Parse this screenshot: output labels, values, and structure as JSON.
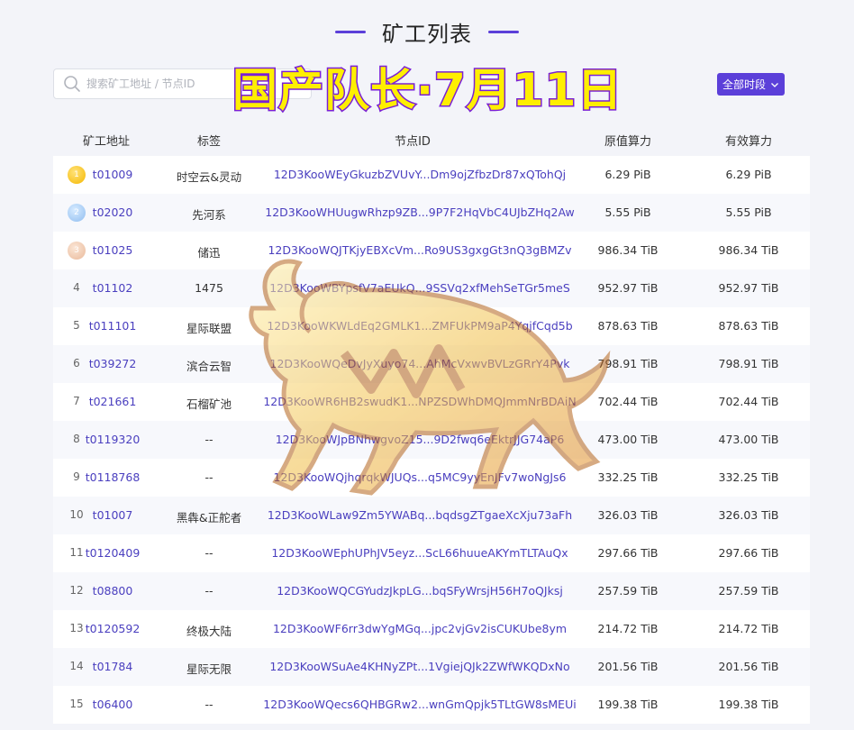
{
  "page": {
    "title": "矿工列表",
    "search_placeholder": "搜索矿工地址 / 节点ID",
    "overlay_text": "国产队长·7月11日",
    "period_button": "全部时段"
  },
  "colors": {
    "accent": "#5b3fd9",
    "link": "#4a3fbf",
    "overlay_fill": "#ffef00",
    "overlay_stroke": "#7a1fd6"
  },
  "table": {
    "headers": {
      "miner": "矿工地址",
      "tag": "标签",
      "node": "节点ID",
      "raw_power": "原值算力",
      "effective_power": "有效算力"
    },
    "rows": [
      {
        "rank": "1",
        "miner": "t01009",
        "tag": "时空云&灵动",
        "node": "12D3KooWEyGkuzbZVUvY...Dm9ojZfbzDr87xQTohQj",
        "raw": "6.29 PiB",
        "eff": "6.29 PiB"
      },
      {
        "rank": "2",
        "miner": "t02020",
        "tag": "先河系",
        "node": "12D3KooWHUugwRhzp9ZB...9P7F2HqVbC4UJbZHq2Aw",
        "raw": "5.55 PiB",
        "eff": "5.55 PiB"
      },
      {
        "rank": "3",
        "miner": "t01025",
        "tag": "储迅",
        "node": "12D3KooWQJTKjyEBXcVm...Ro9US3gxgGt3nQ3gBMZv",
        "raw": "986.34 TiB",
        "eff": "986.34 TiB"
      },
      {
        "rank": "4",
        "miner": "t01102",
        "tag": "1475",
        "node": "12D3KooWBYpsfV7aEUkQ...9SSVq2xfMehSeTGr5meS",
        "raw": "952.97 TiB",
        "eff": "952.97 TiB"
      },
      {
        "rank": "5",
        "miner": "t011101",
        "tag": "星际联盟",
        "node": "12D3KooWKWLdEq2GMLK1...ZMFUkPM9aP4YqjfCqd5b",
        "raw": "878.63 TiB",
        "eff": "878.63 TiB"
      },
      {
        "rank": "6",
        "miner": "t039272",
        "tag": "滨合云智",
        "node": "12D3KooWQeDvJyXuyo74...AhMcVxwvBVLzGRrY4Pvk",
        "raw": "798.91 TiB",
        "eff": "798.91 TiB"
      },
      {
        "rank": "7",
        "miner": "t021661",
        "tag": "石榴矿池",
        "node": "12D3KooWR6HB2swudK1...NPZSDWhDMQJmmNrBDAiN",
        "raw": "702.44 TiB",
        "eff": "702.44 TiB"
      },
      {
        "rank": "8",
        "miner": "t0119320",
        "tag": "--",
        "node": "12D3KooWJpBNhwgvoZ15...9D2fwq6eEktrJJG74aP6",
        "raw": "473.00 TiB",
        "eff": "473.00 TiB"
      },
      {
        "rank": "9",
        "miner": "t0118768",
        "tag": "--",
        "node": "12D3KooWQjhqrqkWJUQs...q5MC9yyEnJFv7woNgJs6",
        "raw": "332.25 TiB",
        "eff": "332.25 TiB"
      },
      {
        "rank": "10",
        "miner": "t01007",
        "tag": "黑犇&正舵者",
        "node": "12D3KooWLaw9Zm5YWABq...bqdsgZTgaeXcXju73aFh",
        "raw": "326.03 TiB",
        "eff": "326.03 TiB"
      },
      {
        "rank": "11",
        "miner": "t0120409",
        "tag": "--",
        "node": "12D3KooWEphUPhJV5eyz...ScL66huueAKYmTLTAuQx",
        "raw": "297.66 TiB",
        "eff": "297.66 TiB"
      },
      {
        "rank": "12",
        "miner": "t08800",
        "tag": "--",
        "node": "12D3KooWQCGYudzJkpLG...bqSFyWrsjH56H7oQJksj",
        "raw": "257.59 TiB",
        "eff": "257.59 TiB"
      },
      {
        "rank": "13",
        "miner": "t0120592",
        "tag": "终极大陆",
        "node": "12D3KooWF6rr3dwYgMGq...jpc2vjGv2isCUKUbe8ym",
        "raw": "214.72 TiB",
        "eff": "214.72 TiB"
      },
      {
        "rank": "14",
        "miner": "t01784",
        "tag": "星际无限",
        "node": "12D3KooWSuAe4KHNyZPt...1VgiejQJk2ZWfWKQDxNo",
        "raw": "201.56 TiB",
        "eff": "201.56 TiB"
      },
      {
        "rank": "15",
        "miner": "t06400",
        "tag": "--",
        "node": "12D3KooWQecs6QHBGRw2...wnGmQpjk5TLtGW8sMEUi",
        "raw": "199.38 TiB",
        "eff": "199.38 TiB"
      }
    ]
  }
}
